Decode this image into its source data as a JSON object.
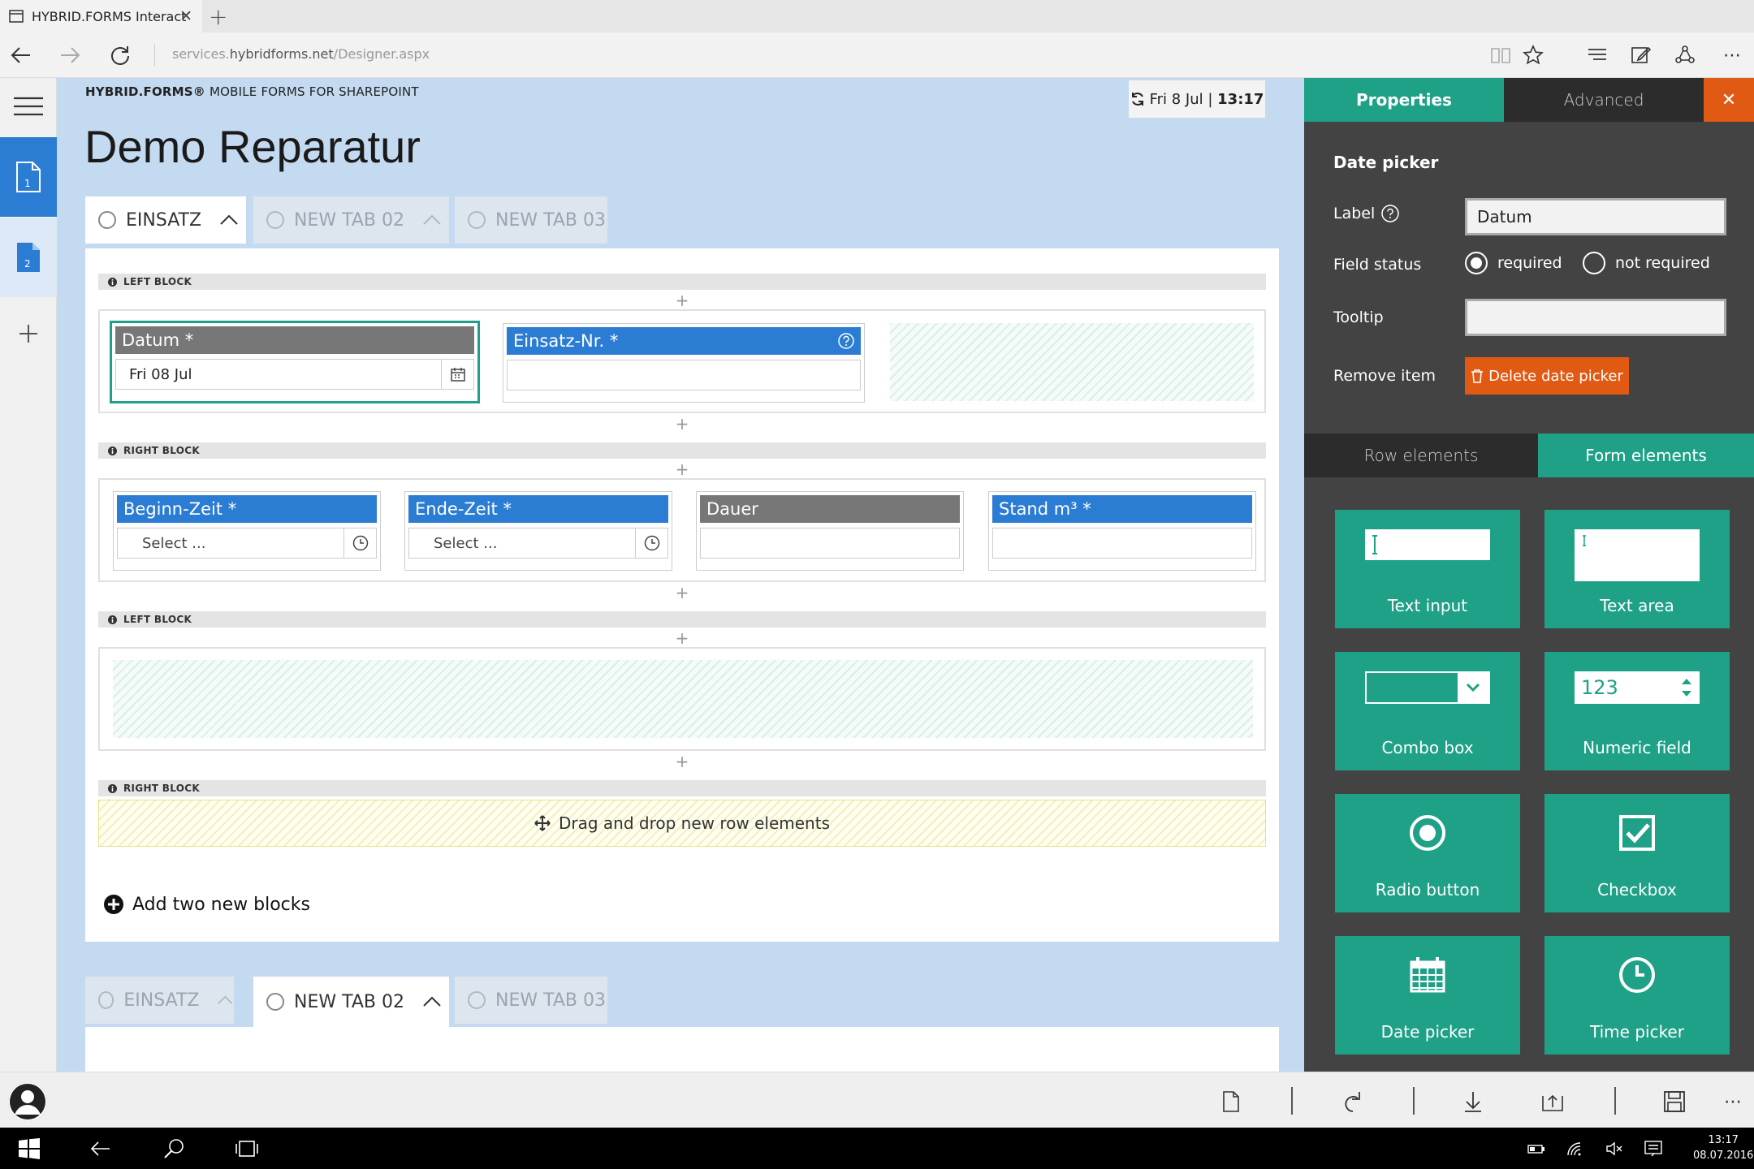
{
  "browser": {
    "tab_title": "HYBRID.FORMS Interact",
    "url_prefix": "services.",
    "url_domain": "hybridforms.net",
    "url_path": "/Designer.aspx"
  },
  "header": {
    "brand_bold": "HYBRID.FORMS®",
    "brand_rest": " MOBILE FORMS FOR SHAREPOINT",
    "date_text": "Fri 8 Jul | ",
    "time_text": "13:17",
    "title": "Demo Reparatur"
  },
  "sidebar": {
    "pages": [
      "1",
      "2"
    ]
  },
  "form_tabs": [
    {
      "label": "EINSATZ"
    },
    {
      "label": "NEW TAB 02"
    },
    {
      "label": "NEW TAB 03"
    }
  ],
  "blocks": {
    "left_block": "LEFT BLOCK",
    "right_block": "RIGHT BLOCK"
  },
  "fields": {
    "datum": {
      "label": "Datum *",
      "value": "Fri 08 Jul"
    },
    "einsatz": {
      "label": "Einsatz-Nr. *"
    },
    "beginn": {
      "label": "Beginn-Zeit *",
      "value": "Select ..."
    },
    "ende": {
      "label": "Ende-Zeit *",
      "value": "Select ..."
    },
    "dauer": {
      "label": "Dauer"
    },
    "stand": {
      "label": "Stand m³ *"
    }
  },
  "dropzone_text": "Drag and drop new row elements",
  "add_blocks_text": "Add two new blocks",
  "properties": {
    "tabs": {
      "properties": "Properties",
      "advanced": "Advanced"
    },
    "section_title": "Date picker",
    "label_label": "Label",
    "label_value": "Datum",
    "field_status_label": "Field status",
    "required": "required",
    "not_required": "not required",
    "tooltip_label": "Tooltip",
    "tooltip_value": "",
    "remove_label": "Remove item",
    "delete_button": "Delete date picker"
  },
  "elements": {
    "tabs": {
      "row": "Row elements",
      "form": "Form elements"
    },
    "tiles": {
      "text_input": "Text input",
      "text_area": "Text area",
      "combo_box": "Combo box",
      "numeric_field": "Numeric field",
      "numeric_sample": "123",
      "radio_button": "Radio button",
      "checkbox": "Checkbox",
      "date_picker": "Date picker",
      "time_picker": "Time picker"
    }
  },
  "taskbar": {
    "time": "13:17",
    "date": "08.07.2016"
  },
  "colors": {
    "accent_teal": "#1fa187",
    "accent_blue": "#2b7cd3",
    "danger_orange": "#e05a13",
    "canvas_bg": "#c4daf1"
  }
}
